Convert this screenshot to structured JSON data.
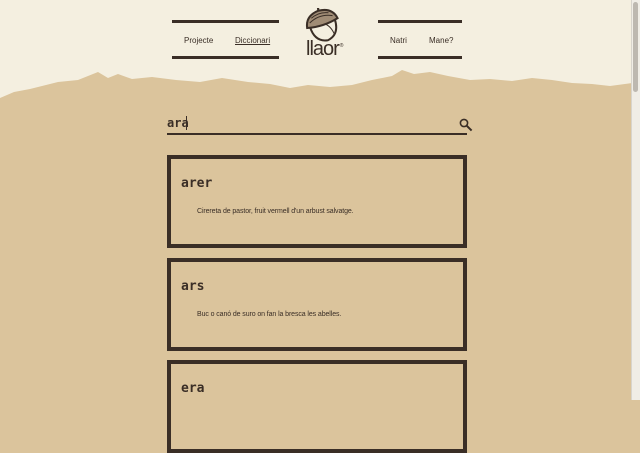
{
  "nav": {
    "left": [
      "Projecte",
      "Diccionari"
    ],
    "right": [
      "Natri",
      "Mane?"
    ],
    "active": "Diccionari"
  },
  "logo": {
    "text": "llaor",
    "mark": "®",
    "icon": "acorn-icon"
  },
  "search": {
    "value": "ara",
    "icon": "search-icon"
  },
  "results": [
    {
      "word": "arer",
      "definition": "Cirereta de pastor, fruit vermell d'un arbust salvatge."
    },
    {
      "word": "ars",
      "definition": "Buc o canó de suro on fan la bresca les abelles."
    },
    {
      "word": "era",
      "definition": ""
    }
  ],
  "colors": {
    "background": "#dbc49c",
    "header": "#f4efe0",
    "ink": "#3a2e26"
  }
}
